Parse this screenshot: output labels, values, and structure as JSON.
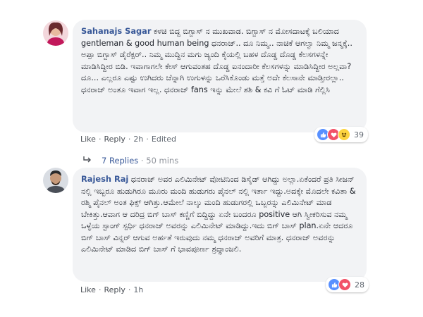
{
  "comments": [
    {
      "author": "Sahanajs Sagar",
      "text_first": "ಕಳಚಿ ಬಿದ್ದ ಬಿಗ್ಬಾಸ್ ನ ಮುಖವಾಡ. ಬಿಗ್ಬಾಸ್ ನ ಮೋಸದಾಟಕ್ಕೆ ಬಲಿಯಾದ gentleman & good human being ಧನರಾಜ್.. ದೂ ನಿಮ್ಮ.. ನಾಚಿಕೆ ಆಗಲ್ವಾ ನಿಮ್ಮ ಜನ್ಮಕ್ಕೆ.. ಅಪ್ಪಾ ಬಿಗ್ಬಾಸ್ ಡೈರೆಕ್ಟರ್.. ನಿಮ್ಮ ಮುದ್ದಿನ ಮಗು ಜ್ಯಂದಿ ಕೈಯಲ್ಲಿ ಬಹಳ ದೊಡ್ಡ ದೊಡ್ಡ ಕೆಲಸಗಳನ್ನೇ ಮಾಡಿಸಿದ್ದೀರ ಬಿಡಿ. ಇವಾಗಾಗಲೇ ಕೇಸ್ ಆಗುವಂತಹ ದೊಡ್ಡ ಐನಂದಾರೀ ಕೆಲಸಗಳನ್ನು ಮಾಡಿಸಿದ್ದೀರ ಅಲ್ಲವಾ? ದೂ... ಎಲ್ಲರೂ ಎಷ್ಟು ಉಗಿದರು ಚೆನ್ನಾಗಿ ಉಗುಳನ್ನು ಒರೆಸಿಕೊಂಡು ಮತ್ತೆ ಅದೇ ಕೆಲಸಾನೇ ಮಾಡ್ತೀರಲ್ಲಾ..",
      "text_second": "ಧನರಾಜ್ ಅಂತೂ ಇವಾಗ ಇಲ್ಲ. ಧನರಾಜ್ fans ಇನ್ನು ಮೇಲೆ ಶಶಿ & ಕವಿ ಗೆ ಓಟ್ ಮಾಡಿ ಗೆಲ್ಲಿಸಿ",
      "like": "Like",
      "reply": "Reply",
      "time": "2h",
      "edited": "Edited",
      "reaction_count": "39",
      "replies_count": "7 Replies",
      "replies_time": "50 mins"
    },
    {
      "author": "Rajesh Raj",
      "text_first": "ಧನರಾಜ್ ಅವರ ಎಲಿಮಿನೇಟ್ ವೋಟಿನಿಂದ ಡಿಸೈಡ್ ಆಗಿದ್ದು ಅಲ್ಲಾ.ಏಕೆಂದರೆ ಪ್ರತಿ ಸೀಜನ್ ನಲ್ಲಿ ಇಬ್ಬರೂ ಹುಡುಗಿರೂ ಮೂರು ಮಂದಿ ಹುಡುಗರು ಪೈನಲ್ ನಲ್ಲಿ ಇರ್ತಾ ಇದ್ದು.ಅದಕ್ಕೇ ಮೊದಲೇ ಕವಿತಾ & ರಶ್ಮಿ ಪೈನಲ್ ಅಂತ ಫಿಕ್ಸ್ ಆಗಿತ್ತು.ಆಮೇಲೆ ನಾಲ್ಕು ಮಂದಿ ಹುಡುಗರಲ್ಲಿ ಒಬ್ಬರನ್ನು ಎಲಿಮಿನೇಟ್ ಮಾಡ ಬೇಕಿತ್ತು.ಆವಾಗ ಆ ದರಿದ್ರ ಬಿಗ್ ಬಾಸ್ ಕಣ್ಣಿಗೆ ಬಿದ್ದಿದ್ದು ಏನೇ ಬಂದರೂ positive ಆಗಿ ಸ್ವೀಕರಿಸುವ ನಮ್ಮ ಒಳ್ಳೆಯ ಸ್ಟಾಂಗ್ ಸ್ಪರ್ಧಿ ಧನರಾಜ್ ಅವರನ್ನು ಎಲಿಮಿನೇಟ್ ಮಾಡಿದ್ದು.ಇದು ಬಿಗ್ ಬಾಸ್ plan.ಏನೇ ಆದರೂ ಬಿಗ್ ಬಾಸ್ ವಿನ್ನರ್ ಆಗುವ ಅರ್ಹತೆ ಇರುವುದು ನಮ್ಮ ಧನರಾಜ್ ಅವರಿಗೆ ಮಾತ್ರ. ಧನರಾಜ್ ಅವರನ್ನು ಎಲಿಮಿನೇಟ್ ಮಾಡಿದ ಬಿಗ್ ಬಾಸ್ ಗೆ ಭಾವಪೂರ್ಣ ಶ್ರದ್ಧಾಂಜಲಿ.",
      "like": "Like",
      "reply": "Reply",
      "time": "1h",
      "reaction_count": "28"
    }
  ],
  "colors": {
    "link": "#385898",
    "bubble": "#f2f3f5",
    "like": "#5890ff",
    "love": "#f25268",
    "haha": "#fcd440"
  },
  "icons": {
    "reply_arrow": "reply-arrow-icon",
    "like": "like-reaction-icon",
    "love": "love-reaction-icon",
    "haha": "haha-reaction-icon"
  }
}
